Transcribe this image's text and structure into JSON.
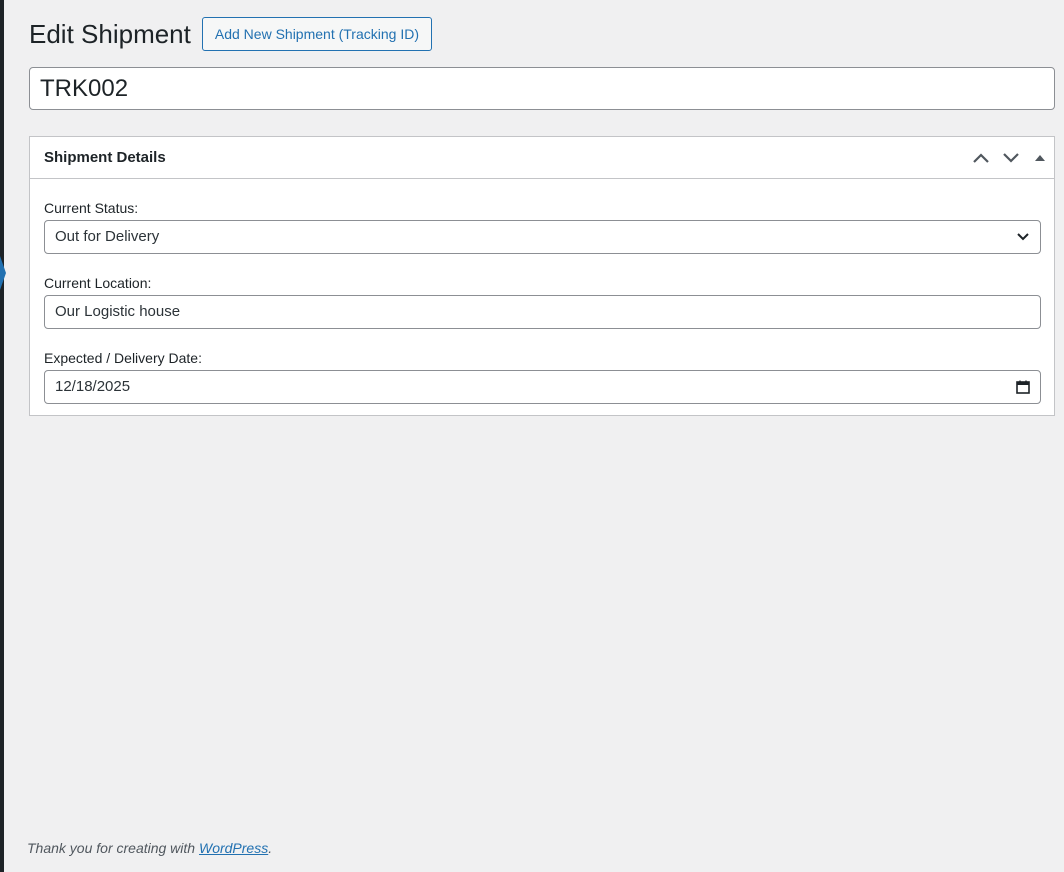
{
  "page": {
    "title": "Edit Shipment",
    "add_new_label": "Add New Shipment (Tracking ID)"
  },
  "post": {
    "title_value": "TRK002"
  },
  "metabox": {
    "title": "Shipment Details",
    "fields": {
      "status": {
        "label": "Current Status:",
        "value": "Out for Delivery"
      },
      "location": {
        "label": "Current Location:",
        "value": "Our Logistic house"
      },
      "date": {
        "label": "Expected / Delivery Date:",
        "value": "12/18/2025"
      }
    }
  },
  "footer": {
    "prefix": "Thank you for creating with ",
    "link": "WordPress",
    "suffix": "."
  },
  "icons": {
    "move_up": "chevron-up-icon",
    "move_down": "chevron-down-icon",
    "toggle": "triangle-up-icon",
    "select_arrow": "chevron-down-icon",
    "calendar": "calendar-icon"
  },
  "colors": {
    "accent": "#2271b1",
    "admin_bar": "#1d2327",
    "background": "#f0f0f1"
  }
}
